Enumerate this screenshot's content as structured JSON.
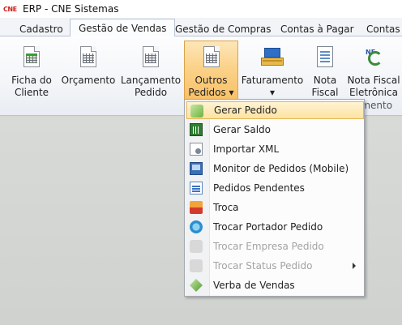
{
  "window": {
    "app_icon_text": "CNE",
    "title": "ERP - CNE Sistemas"
  },
  "tabs": [
    {
      "label": "Cadastro",
      "active": false
    },
    {
      "label": "Gestão de Vendas",
      "active": true
    },
    {
      "label": "Gestão de Compras",
      "active": false
    },
    {
      "label": "Contas à Pagar",
      "active": false
    },
    {
      "label": "Contas à",
      "active": false
    }
  ],
  "ribbon": {
    "buttons": [
      {
        "line1": "Ficha do",
        "line2": "Cliente",
        "icon": "spreadsheet-icon"
      },
      {
        "line1": "Orçamento",
        "line2": "",
        "icon": "document-grid-icon"
      },
      {
        "line1": "Lançamento",
        "line2": "Pedido",
        "icon": "document-grid-icon"
      },
      {
        "line1": "Outros",
        "line2": "Pedidos ▾",
        "icon": "document-grid-icon",
        "pressed": true
      },
      {
        "line1": "Faturamento",
        "line2": "▾",
        "icon": "cash-register-icon"
      },
      {
        "line1": "Nota",
        "line2": "Fiscal",
        "icon": "invoice-icon"
      },
      {
        "line1": "Nota Fiscal",
        "line2": "Eletrônica",
        "icon": "nfe-icon"
      }
    ],
    "group_label": "amento"
  },
  "menu": {
    "items": [
      {
        "label": "Gerar Pedido",
        "icon": "generate-order-icon",
        "enabled": true,
        "highlighted": true
      },
      {
        "label": "Gerar Saldo",
        "icon": "generate-balance-icon",
        "enabled": true
      },
      {
        "label": "Importar XML",
        "icon": "import-xml-icon",
        "enabled": true
      },
      {
        "label": "Monitor de Pedidos (Mobile)",
        "icon": "monitor-icon",
        "enabled": true
      },
      {
        "label": "Pedidos Pendentes",
        "icon": "pending-orders-icon",
        "enabled": true
      },
      {
        "label": "Troca",
        "icon": "exchange-icon",
        "enabled": true
      },
      {
        "label": "Trocar Portador Pedido",
        "icon": "swap-carrier-icon",
        "enabled": true
      },
      {
        "label": "Trocar Empresa Pedido",
        "icon": "swap-company-icon",
        "enabled": false
      },
      {
        "label": "Trocar Status Pedido",
        "icon": "swap-status-icon",
        "enabled": false,
        "submenu": true
      },
      {
        "label": "Verba de Vendas",
        "icon": "sales-budget-icon",
        "enabled": true
      }
    ]
  },
  "colors": {
    "highlight": "#fde3a2",
    "pressed": "#f9c167",
    "disabled_text": "#a3a3a3"
  }
}
